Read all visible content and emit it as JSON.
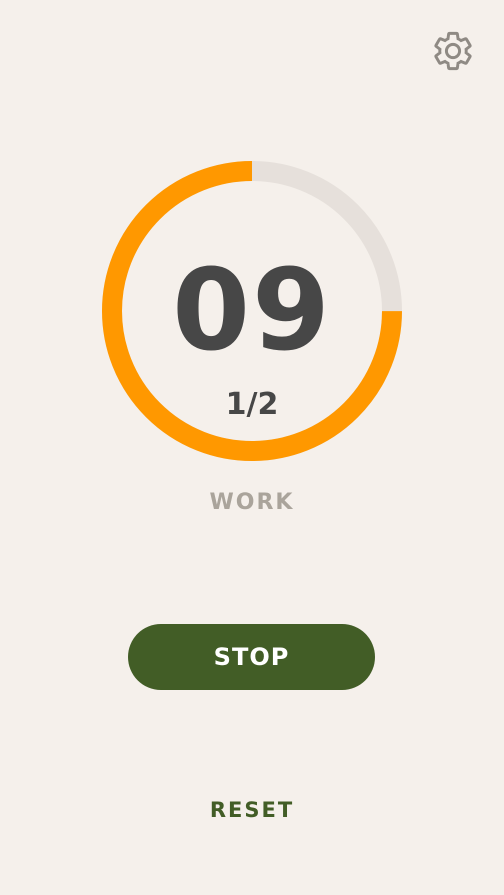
{
  "colors": {
    "background": "#f5f0eb",
    "ring_progress": "#ff9800",
    "ring_track": "#e6e0db",
    "time_text": "#474747",
    "phase_text": "#aaa49b",
    "primary_button": "#425d26",
    "gear_icon": "#8f8a84"
  },
  "header": {
    "settings_icon": "gear-icon"
  },
  "timer": {
    "time": "09",
    "round": "1/2",
    "phase": "WORK",
    "progress": 0.75
  },
  "controls": {
    "stop_label": "STOP",
    "reset_label": "RESET"
  }
}
